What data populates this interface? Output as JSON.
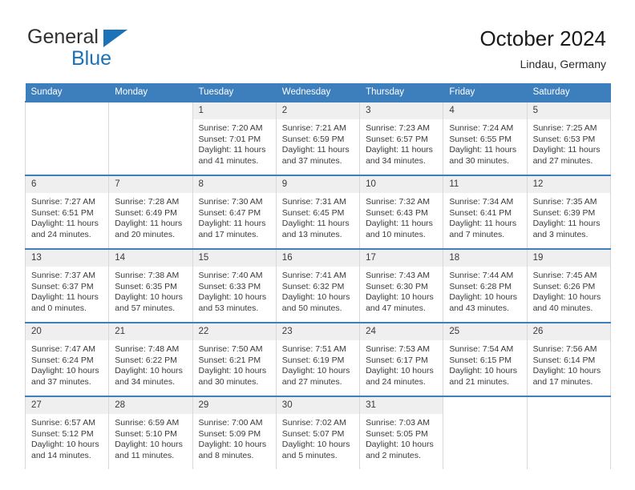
{
  "brand": {
    "line1": "General",
    "line2": "Blue",
    "triangle_color": "#1b72b8"
  },
  "header": {
    "title": "October 2024",
    "subtitle": "Lindau, Germany",
    "header_bg": "#3d7ebd",
    "daynum_bg": "#efefef"
  },
  "weekdays": [
    "Sunday",
    "Monday",
    "Tuesday",
    "Wednesday",
    "Thursday",
    "Friday",
    "Saturday"
  ],
  "labels": {
    "sunrise_prefix": "Sunrise:",
    "sunset_prefix": "Sunset:",
    "daylight_prefix": "Daylight:"
  },
  "weeks": [
    [
      {
        "day": "",
        "sunrise": "",
        "sunset": "",
        "daylight_l1": "",
        "daylight_l2": "",
        "empty": true
      },
      {
        "day": "",
        "sunrise": "",
        "sunset": "",
        "daylight_l1": "",
        "daylight_l2": "",
        "empty": true
      },
      {
        "day": "1",
        "sunrise": "Sunrise: 7:20 AM",
        "sunset": "Sunset: 7:01 PM",
        "daylight_l1": "Daylight: 11 hours",
        "daylight_l2": "and 41 minutes."
      },
      {
        "day": "2",
        "sunrise": "Sunrise: 7:21 AM",
        "sunset": "Sunset: 6:59 PM",
        "daylight_l1": "Daylight: 11 hours",
        "daylight_l2": "and 37 minutes."
      },
      {
        "day": "3",
        "sunrise": "Sunrise: 7:23 AM",
        "sunset": "Sunset: 6:57 PM",
        "daylight_l1": "Daylight: 11 hours",
        "daylight_l2": "and 34 minutes."
      },
      {
        "day": "4",
        "sunrise": "Sunrise: 7:24 AM",
        "sunset": "Sunset: 6:55 PM",
        "daylight_l1": "Daylight: 11 hours",
        "daylight_l2": "and 30 minutes."
      },
      {
        "day": "5",
        "sunrise": "Sunrise: 7:25 AM",
        "sunset": "Sunset: 6:53 PM",
        "daylight_l1": "Daylight: 11 hours",
        "daylight_l2": "and 27 minutes."
      }
    ],
    [
      {
        "day": "6",
        "sunrise": "Sunrise: 7:27 AM",
        "sunset": "Sunset: 6:51 PM",
        "daylight_l1": "Daylight: 11 hours",
        "daylight_l2": "and 24 minutes."
      },
      {
        "day": "7",
        "sunrise": "Sunrise: 7:28 AM",
        "sunset": "Sunset: 6:49 PM",
        "daylight_l1": "Daylight: 11 hours",
        "daylight_l2": "and 20 minutes."
      },
      {
        "day": "8",
        "sunrise": "Sunrise: 7:30 AM",
        "sunset": "Sunset: 6:47 PM",
        "daylight_l1": "Daylight: 11 hours",
        "daylight_l2": "and 17 minutes."
      },
      {
        "day": "9",
        "sunrise": "Sunrise: 7:31 AM",
        "sunset": "Sunset: 6:45 PM",
        "daylight_l1": "Daylight: 11 hours",
        "daylight_l2": "and 13 minutes."
      },
      {
        "day": "10",
        "sunrise": "Sunrise: 7:32 AM",
        "sunset": "Sunset: 6:43 PM",
        "daylight_l1": "Daylight: 11 hours",
        "daylight_l2": "and 10 minutes."
      },
      {
        "day": "11",
        "sunrise": "Sunrise: 7:34 AM",
        "sunset": "Sunset: 6:41 PM",
        "daylight_l1": "Daylight: 11 hours",
        "daylight_l2": "and 7 minutes."
      },
      {
        "day": "12",
        "sunrise": "Sunrise: 7:35 AM",
        "sunset": "Sunset: 6:39 PM",
        "daylight_l1": "Daylight: 11 hours",
        "daylight_l2": "and 3 minutes."
      }
    ],
    [
      {
        "day": "13",
        "sunrise": "Sunrise: 7:37 AM",
        "sunset": "Sunset: 6:37 PM",
        "daylight_l1": "Daylight: 11 hours",
        "daylight_l2": "and 0 minutes."
      },
      {
        "day": "14",
        "sunrise": "Sunrise: 7:38 AM",
        "sunset": "Sunset: 6:35 PM",
        "daylight_l1": "Daylight: 10 hours",
        "daylight_l2": "and 57 minutes."
      },
      {
        "day": "15",
        "sunrise": "Sunrise: 7:40 AM",
        "sunset": "Sunset: 6:33 PM",
        "daylight_l1": "Daylight: 10 hours",
        "daylight_l2": "and 53 minutes."
      },
      {
        "day": "16",
        "sunrise": "Sunrise: 7:41 AM",
        "sunset": "Sunset: 6:32 PM",
        "daylight_l1": "Daylight: 10 hours",
        "daylight_l2": "and 50 minutes."
      },
      {
        "day": "17",
        "sunrise": "Sunrise: 7:43 AM",
        "sunset": "Sunset: 6:30 PM",
        "daylight_l1": "Daylight: 10 hours",
        "daylight_l2": "and 47 minutes."
      },
      {
        "day": "18",
        "sunrise": "Sunrise: 7:44 AM",
        "sunset": "Sunset: 6:28 PM",
        "daylight_l1": "Daylight: 10 hours",
        "daylight_l2": "and 43 minutes."
      },
      {
        "day": "19",
        "sunrise": "Sunrise: 7:45 AM",
        "sunset": "Sunset: 6:26 PM",
        "daylight_l1": "Daylight: 10 hours",
        "daylight_l2": "and 40 minutes."
      }
    ],
    [
      {
        "day": "20",
        "sunrise": "Sunrise: 7:47 AM",
        "sunset": "Sunset: 6:24 PM",
        "daylight_l1": "Daylight: 10 hours",
        "daylight_l2": "and 37 minutes."
      },
      {
        "day": "21",
        "sunrise": "Sunrise: 7:48 AM",
        "sunset": "Sunset: 6:22 PM",
        "daylight_l1": "Daylight: 10 hours",
        "daylight_l2": "and 34 minutes."
      },
      {
        "day": "22",
        "sunrise": "Sunrise: 7:50 AM",
        "sunset": "Sunset: 6:21 PM",
        "daylight_l1": "Daylight: 10 hours",
        "daylight_l2": "and 30 minutes."
      },
      {
        "day": "23",
        "sunrise": "Sunrise: 7:51 AM",
        "sunset": "Sunset: 6:19 PM",
        "daylight_l1": "Daylight: 10 hours",
        "daylight_l2": "and 27 minutes."
      },
      {
        "day": "24",
        "sunrise": "Sunrise: 7:53 AM",
        "sunset": "Sunset: 6:17 PM",
        "daylight_l1": "Daylight: 10 hours",
        "daylight_l2": "and 24 minutes."
      },
      {
        "day": "25",
        "sunrise": "Sunrise: 7:54 AM",
        "sunset": "Sunset: 6:15 PM",
        "daylight_l1": "Daylight: 10 hours",
        "daylight_l2": "and 21 minutes."
      },
      {
        "day": "26",
        "sunrise": "Sunrise: 7:56 AM",
        "sunset": "Sunset: 6:14 PM",
        "daylight_l1": "Daylight: 10 hours",
        "daylight_l2": "and 17 minutes."
      }
    ],
    [
      {
        "day": "27",
        "sunrise": "Sunrise: 6:57 AM",
        "sunset": "Sunset: 5:12 PM",
        "daylight_l1": "Daylight: 10 hours",
        "daylight_l2": "and 14 minutes."
      },
      {
        "day": "28",
        "sunrise": "Sunrise: 6:59 AM",
        "sunset": "Sunset: 5:10 PM",
        "daylight_l1": "Daylight: 10 hours",
        "daylight_l2": "and 11 minutes."
      },
      {
        "day": "29",
        "sunrise": "Sunrise: 7:00 AM",
        "sunset": "Sunset: 5:09 PM",
        "daylight_l1": "Daylight: 10 hours",
        "daylight_l2": "and 8 minutes."
      },
      {
        "day": "30",
        "sunrise": "Sunrise: 7:02 AM",
        "sunset": "Sunset: 5:07 PM",
        "daylight_l1": "Daylight: 10 hours",
        "daylight_l2": "and 5 minutes."
      },
      {
        "day": "31",
        "sunrise": "Sunrise: 7:03 AM",
        "sunset": "Sunset: 5:05 PM",
        "daylight_l1": "Daylight: 10 hours",
        "daylight_l2": "and 2 minutes."
      },
      {
        "day": "",
        "sunrise": "",
        "sunset": "",
        "daylight_l1": "",
        "daylight_l2": "",
        "empty": true
      },
      {
        "day": "",
        "sunrise": "",
        "sunset": "",
        "daylight_l1": "",
        "daylight_l2": "",
        "empty": true
      }
    ]
  ]
}
